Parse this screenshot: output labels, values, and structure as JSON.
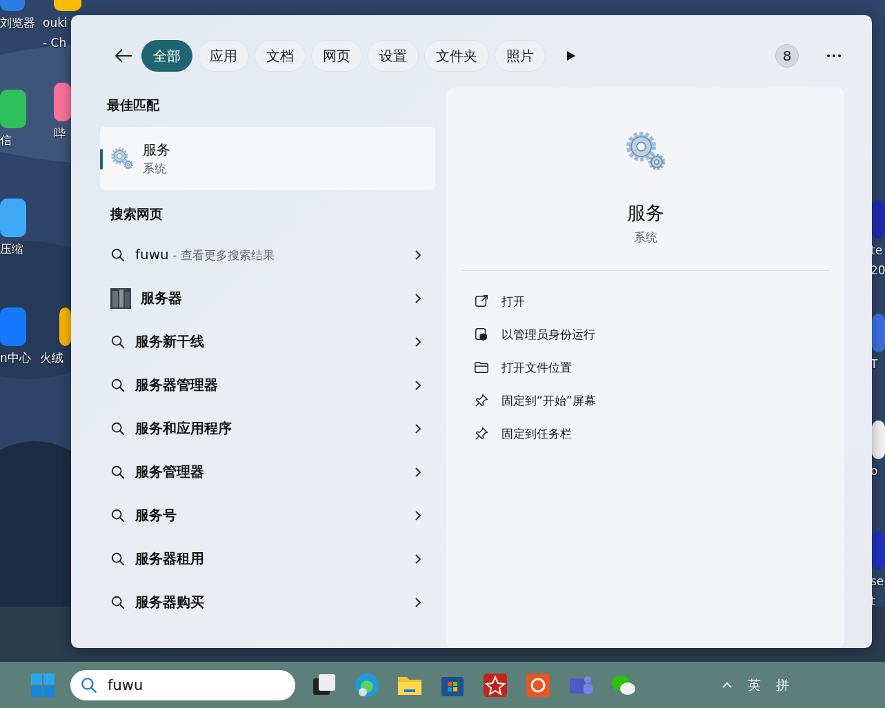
{
  "desktop_icons": [
    {
      "lines": [
        "刘览器"
      ]
    },
    {
      "lines": [
        "ouki",
        "- Ch"
      ]
    },
    {
      "lines": [
        "信"
      ]
    },
    {
      "lines": [
        "哔"
      ]
    },
    {
      "lines": [
        "压缩"
      ]
    },
    {
      "lines": [
        "n中心"
      ]
    },
    {
      "lines": [
        "火绒"
      ]
    },
    {
      "lines": [
        "te",
        "20"
      ]
    },
    {
      "lines": [
        "T"
      ]
    },
    {
      "lines": [
        "o"
      ]
    },
    {
      "lines": [
        "se",
        "t"
      ]
    }
  ],
  "search_panel": {
    "filters": [
      {
        "label": "全部",
        "selected": true
      },
      {
        "label": "应用",
        "selected": false
      },
      {
        "label": "文档",
        "selected": false
      },
      {
        "label": "网页",
        "selected": false
      },
      {
        "label": "设置",
        "selected": false
      },
      {
        "label": "文件夹",
        "selected": false
      },
      {
        "label": "照片",
        "selected": false
      }
    ],
    "points": "8",
    "best_match_heading": "最佳匹配",
    "best_match": {
      "title": "服务",
      "subtitle": "系统",
      "selected": true
    },
    "web_heading": "搜索网页",
    "web_results": [
      {
        "kind": "query",
        "text": "fuwu",
        "suffix": "- 查看更多搜索结果"
      },
      {
        "text": "服务器"
      },
      {
        "kind": "query",
        "text": "服务新干线"
      },
      {
        "kind": "query",
        "text": "服务器管理器"
      },
      {
        "kind": "query",
        "text": "服务和应用程序"
      },
      {
        "kind": "query",
        "text": "服务管理器"
      },
      {
        "kind": "query",
        "text": "服务号"
      },
      {
        "kind": "query",
        "text": "服务器租用"
      },
      {
        "kind": "query",
        "text": "服务器购买"
      }
    ],
    "detail": {
      "title": "服务",
      "subtitle": "系统",
      "actions": [
        {
          "kind": "open",
          "label": "打开"
        },
        {
          "kind": "admin",
          "label": "以管理员身份运行"
        },
        {
          "kind": "folder",
          "label": "打开文件位置"
        },
        {
          "kind": "pin",
          "label": "固定到“开始”屏幕"
        },
        {
          "kind": "pin",
          "label": "固定到任务栏"
        }
      ]
    }
  },
  "taskbar": {
    "search_value": "fuwu",
    "tray": [
      "英",
      "拼"
    ]
  }
}
